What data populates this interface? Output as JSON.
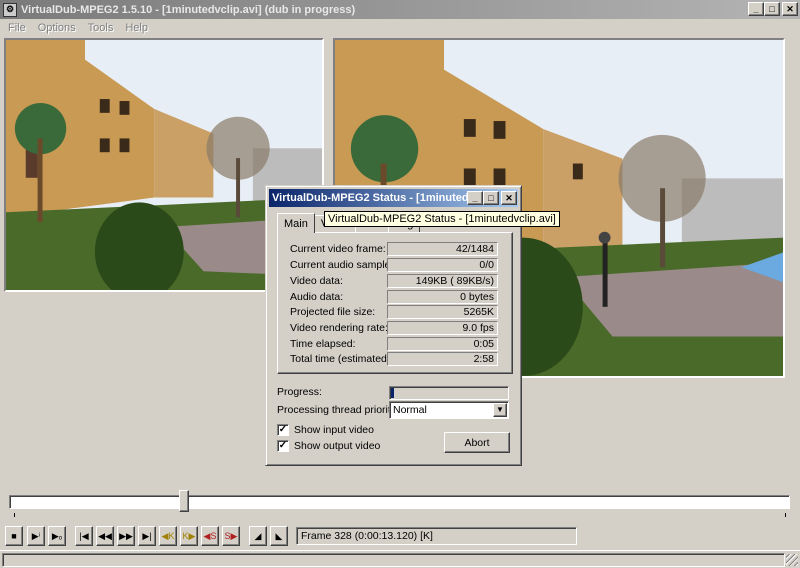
{
  "window": {
    "title": "VirtualDub-MPEG2 1.5.10 - [1minutedvclip.avi] (dub in progress)",
    "minimize": "_",
    "maximize": "□",
    "close": "✕"
  },
  "menu": [
    "File",
    "Options",
    "Tools",
    "Help"
  ],
  "panes": {
    "input": "input-video",
    "output": "output-video"
  },
  "dialog": {
    "title": "VirtualDub-MPEG2 Status - [1minutedv...",
    "tooltip": "VirtualDub-MPEG2 Status - [1minutedvclip.avi]",
    "tabs": [
      "Main",
      "Video",
      "Perf",
      "Log"
    ],
    "active_tab": "Main",
    "stats": [
      {
        "label": "Current video frame:",
        "value": "42/1484"
      },
      {
        "label": "Current audio sample:",
        "value": "0/0"
      },
      {
        "label": "Video data:",
        "value": "149KB ( 89KB/s)"
      },
      {
        "label": "Audio data:",
        "value": "0 bytes"
      },
      {
        "label": "Projected file size:",
        "value": "5265K"
      },
      {
        "label": "Video rendering rate:",
        "value": "9.0 fps"
      },
      {
        "label": "Time elapsed:",
        "value": "0:05"
      },
      {
        "label": "Total time (estimated):",
        "value": "2:58"
      }
    ],
    "progress_label": "Progress:",
    "progress_fraction": 0.03,
    "priority_label": "Processing thread priority:",
    "priority_value": "Normal",
    "show_input_label": "Show input video",
    "show_input_checked": true,
    "show_output_label": "Show output video",
    "show_output_checked": true,
    "abort_label": "Abort"
  },
  "timeline": {
    "position_fraction": 0.22
  },
  "toolbar": {
    "buttons": [
      "stop-icon",
      "play-input-icon",
      "play-output-icon",
      "go-start-icon",
      "step-back-icon",
      "step-forward-icon",
      "go-end-icon",
      "prev-key-icon",
      "next-key-icon",
      "prev-scene-icon",
      "next-scene-icon",
      "mark-in-icon",
      "mark-out-icon"
    ],
    "frame_status": "Frame 328 (0:00:13.120) [K]"
  },
  "colors": {
    "face": "#d4d0c8",
    "title_active": "#0a246a",
    "title_inactive": "#808080",
    "progress": "#0a246a"
  }
}
